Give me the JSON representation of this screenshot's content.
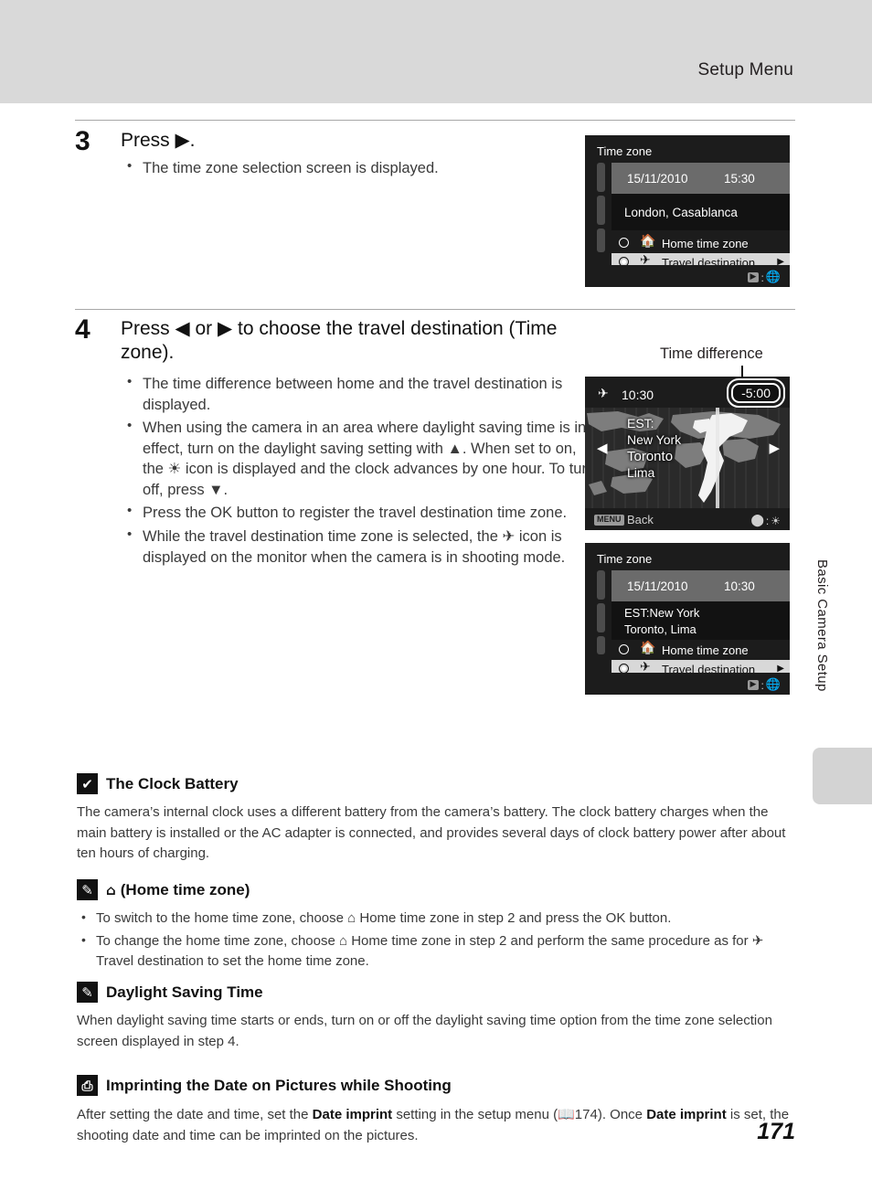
{
  "header": {
    "title": "Setup Menu"
  },
  "sidebar": {
    "tab_label": "Basic Camera Setup"
  },
  "page_number": "171",
  "steps": [
    {
      "number": "3",
      "heading_pre": "Press ",
      "heading_glyph": "▶",
      "heading_post": ".",
      "bullets": [
        "The time zone selection screen is displayed."
      ]
    },
    {
      "number": "4",
      "heading_pre": "Press ",
      "heading_glyph_left": "◀",
      "heading_mid": " or ",
      "heading_glyph_right": "▶",
      "heading_post": " to choose the travel destination (Time zone).",
      "bullets": [
        "The time difference between home and the travel destination is displayed.",
        "When using the camera in an area where daylight saving time is in effect, turn on the daylight saving setting with ▲. When set to on, the ☀ icon is displayed and the clock advances by one hour. To turn off, press ▼.",
        "Press the OK button to register the travel destination time zone.",
        "While the travel destination time zone is selected, the ✈ icon is displayed on the monitor when the camera is in shooting mode."
      ]
    }
  ],
  "callout": {
    "time_difference_label": "Time difference"
  },
  "screens": {
    "screen1": {
      "title": "Time zone",
      "date": "15/11/2010",
      "time": "15:30",
      "zone_name": "London, Casablanca",
      "options": [
        {
          "label": "Home time zone",
          "icon": "home-icon",
          "selected": false
        },
        {
          "label": "Travel destination",
          "icon": "plane-icon",
          "selected": true
        }
      ],
      "hint_left_icon": "play-button-icon",
      "hint_sep": ":",
      "hint_right_icon": "globe-icon"
    },
    "screen2": {
      "plane_icon": "plane-icon",
      "time": "10:30",
      "time_difference": "-5:00",
      "city_lines": [
        "EST:",
        "New York",
        "Toronto",
        "Lima"
      ],
      "arrow_left": "◀",
      "arrow_right": "▶",
      "menu_badge": "MENU",
      "back_label": "Back",
      "hint_left_icon": "updown-pad-icon",
      "hint_sep": ":",
      "hint_right_icon": "daylight-saving-icon"
    },
    "screen3": {
      "title": "Time zone",
      "date": "15/11/2010",
      "time": "10:30",
      "zone_line1": "EST:New York",
      "zone_line2": "Toronto, Lima",
      "options": [
        {
          "label": "Home time zone",
          "icon": "home-icon",
          "selected": false
        },
        {
          "label": "Travel destination",
          "icon": "plane-icon",
          "selected": true
        }
      ],
      "hint_left_icon": "play-button-icon",
      "hint_sep": ":",
      "hint_right_icon": "globe-icon"
    }
  },
  "notes": [
    {
      "id": "clock-battery",
      "icon": "caution-checkmark-icon",
      "icon_glyph": "✔",
      "title": "The Clock Battery",
      "body": "The camera’s internal clock uses a different battery from the camera’s battery. The clock battery charges when the main battery is installed or the AC adapter is connected, and provides several days of clock battery power after about ten hours of charging."
    },
    {
      "id": "home-time-zone",
      "icon": "pencil-note-icon",
      "icon_glyph": "✎",
      "title_icon": "home-icon",
      "title": "(Home time zone)",
      "bullets": [
        "To switch to the home time zone, choose ⌂ Home time zone in step 2 and press the OK button.",
        "To change the home time zone, choose ⌂ Home time zone in step 2 and perform the same procedure as for ✈ Travel destination to set the home time zone."
      ]
    },
    {
      "id": "daylight-saving-time",
      "icon": "pencil-note-icon",
      "icon_glyph": "✎",
      "title": "Daylight Saving Time",
      "body": "When daylight saving time starts or ends, turn on or off the daylight saving time option from the time zone selection screen displayed in step 4."
    },
    {
      "id": "date-imprint",
      "icon": "date-imprint-icon",
      "icon_glyph": "⎙",
      "title": "Imprinting the Date on Pictures while Shooting",
      "body_pre": "After setting the date and time, set the ",
      "body_b1": "Date imprint",
      "body_mid": " setting in the setup menu (",
      "body_ref": "174",
      "body_mid2": "). Once ",
      "body_b2": "Date imprint",
      "body_post": " is set, the shooting date and time can be imprinted on the pictures."
    }
  ]
}
